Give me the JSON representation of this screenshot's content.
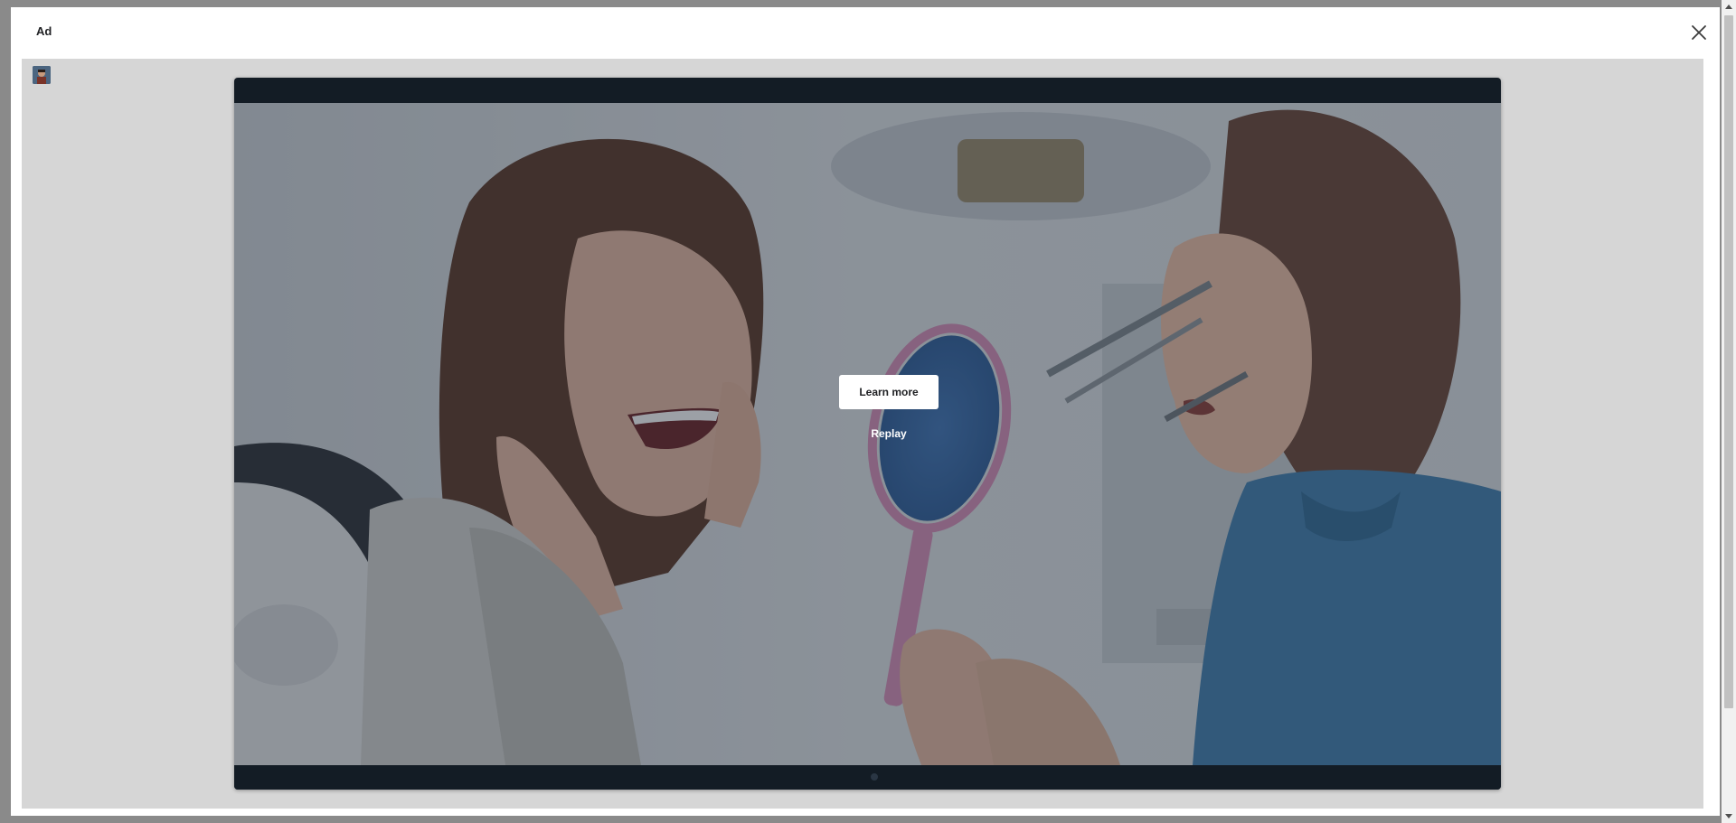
{
  "modal": {
    "title": "Ad",
    "close_icon": "close-icon"
  },
  "avatar": {
    "icon": "advertiser-avatar"
  },
  "player": {
    "learn_more_label": "Learn more",
    "replay_label": "Replay"
  },
  "colors": {
    "overlay_tint": "#232d3a",
    "player_bar": "#131c25",
    "body_bg": "#d6d6d6"
  }
}
